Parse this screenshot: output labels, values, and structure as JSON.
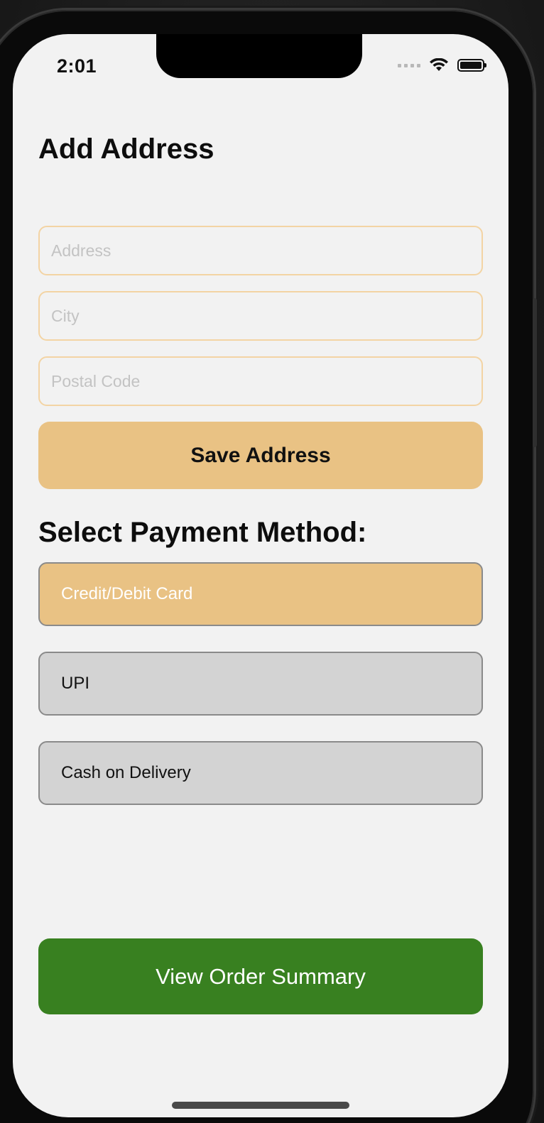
{
  "status_bar": {
    "time": "2:01"
  },
  "address_form": {
    "title": "Add Address",
    "address_placeholder": "Address",
    "city_placeholder": "City",
    "postal_code_placeholder": "Postal Code",
    "save_label": "Save Address"
  },
  "payment": {
    "title": "Select Payment Method:",
    "options": [
      {
        "label": "Credit/Debit Card",
        "selected": true
      },
      {
        "label": "UPI",
        "selected": false
      },
      {
        "label": "Cash on Delivery",
        "selected": false
      }
    ]
  },
  "actions": {
    "view_summary_label": "View Order Summary"
  },
  "colors": {
    "accent": "#e9c284",
    "field_border": "#f3d4a4",
    "unselected_option": "#d3d3d3",
    "primary_action": "#388020",
    "background": "#f2f2f2"
  }
}
